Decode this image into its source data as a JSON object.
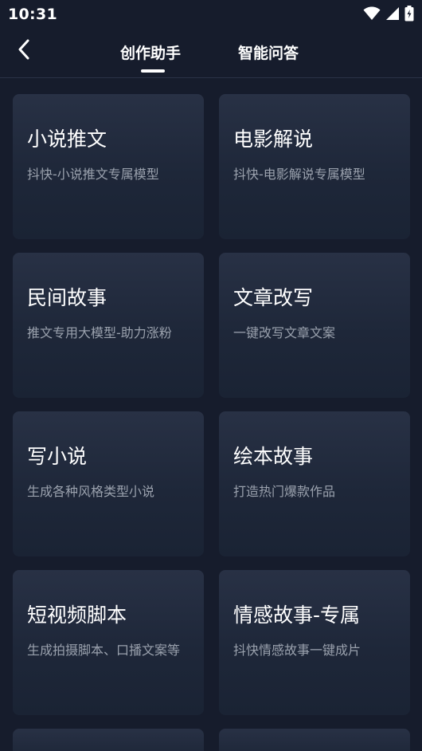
{
  "status_bar": {
    "time": "10:31",
    "icons": [
      "wifi-icon",
      "signal-icon",
      "battery-icon"
    ]
  },
  "header": {
    "back_icon": "chevron-left-icon",
    "tabs": [
      {
        "label": "创作助手",
        "active": true
      },
      {
        "label": "智能问答",
        "active": false
      }
    ]
  },
  "cards": [
    {
      "title": "小说推文",
      "desc": "抖快-小说推文专属模型"
    },
    {
      "title": "电影解说",
      "desc": "抖快-电影解说专属模型"
    },
    {
      "title": "民间故事",
      "desc": "推文专用大模型-助力涨粉"
    },
    {
      "title": "文章改写",
      "desc": "一键改写文章文案"
    },
    {
      "title": "写小说",
      "desc": "生成各种风格类型小说"
    },
    {
      "title": "绘本故事",
      "desc": "打造热门爆款作品"
    },
    {
      "title": "短视频脚本",
      "desc": "生成拍摄脚本、口播文案等"
    },
    {
      "title": "情感故事-专属",
      "desc": "抖快情感故事一键成片"
    }
  ],
  "colors": {
    "background": "#161c2c",
    "card": "#232c40",
    "desc_text": "#9aa1ad",
    "text": "#ffffff"
  }
}
